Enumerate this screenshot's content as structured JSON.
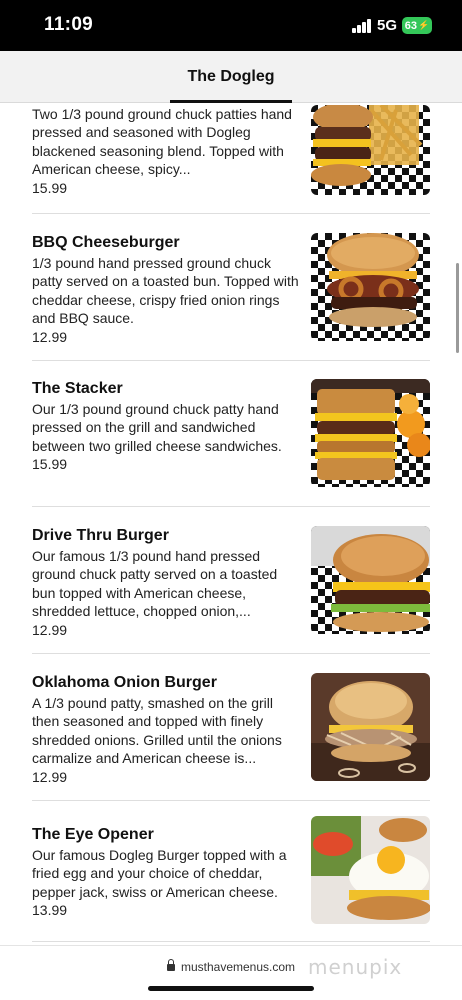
{
  "status": {
    "time": "11:09",
    "network": "5G",
    "battery": "63"
  },
  "header": {
    "title": "The Dogleg"
  },
  "items": [
    {
      "name": "",
      "description": "Two 1/3 pound ground chuck patties hand pressed and seasoned with Dogleg blackened seasoning blend. Topped with American cheese, spicy...",
      "price": "15.99"
    },
    {
      "name": "BBQ Cheeseburger",
      "description": "1/3 pound hand pressed ground chuck patty served on a toasted bun. Topped with cheddar cheese, crispy fried onion rings and BBQ sauce.",
      "price": "12.99"
    },
    {
      "name": "The Stacker",
      "description": "Our 1/3 pound ground chuck patty hand pressed on the grill and sandwiched between two grilled cheese sandwiches.",
      "price": "15.99"
    },
    {
      "name": "Drive Thru Burger",
      "description": "Our famous 1/3 pound hand pressed ground chuck patty served on a toasted bun topped with American cheese, shredded lettuce, chopped onion,...",
      "price": "12.99"
    },
    {
      "name": "Oklahoma Onion Burger",
      "description": "A 1/3 pound patty, smashed on the grill then seasoned and topped with finely shredded onions. Grilled until the onions carmalize and American cheese is...",
      "price": "12.99"
    },
    {
      "name": "The Eye Opener",
      "description": "Our famous Dogleg Burger topped with a fried egg and your choice of cheddar, pepper jack, swiss or American cheese.",
      "price": "13.99"
    }
  ],
  "browser": {
    "url": "musthavemenus.com",
    "watermark": "menupix"
  }
}
